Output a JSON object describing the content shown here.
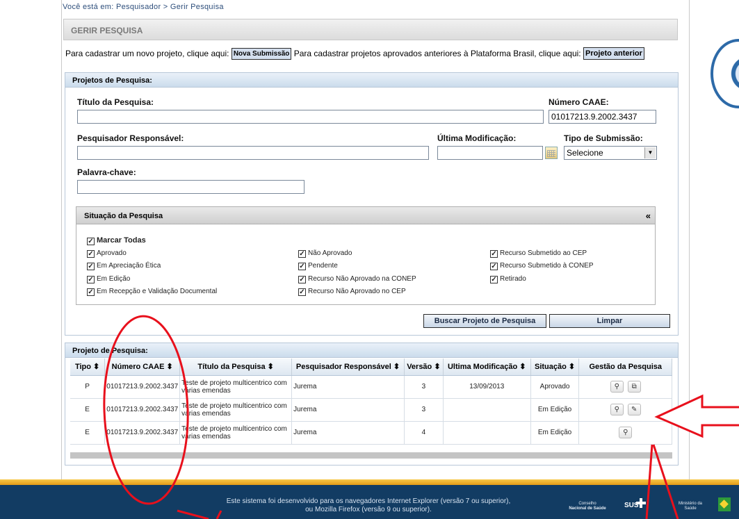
{
  "breadcrumb": "Você está em: Pesquisador > Gerir Pesquisa",
  "page_title": "GERIR PESQUISA",
  "submission": {
    "text_new": "Para cadastrar um novo projeto, clique aqui:",
    "btn_new": "Nova Submissão",
    "text_previous": "Para cadastrar projetos aprovados anteriores à Plataforma Brasil, clique aqui:",
    "btn_previous": "Projeto anterior"
  },
  "search": {
    "header": "Projetos de Pesquisa:",
    "titulo_label": "Título da Pesquisa:",
    "titulo_value": "",
    "caae_label": "Número CAAE:",
    "caae_value": "01017213.9.2002.3437",
    "pesquisador_label": "Pesquisador Responsável:",
    "pesquisador_value": "",
    "modificacao_label": "Última Modificação:",
    "modificacao_value": "",
    "tipo_label": "Tipo de Submissão:",
    "tipo_value": "Selecione",
    "palavra_label": "Palavra-chave:",
    "palavra_value": ""
  },
  "situacao": {
    "header": "Situação da Pesquisa",
    "collapse_glyph": "«",
    "check_glyph": "✓",
    "marcar_todas": "Marcar Todas",
    "col1": [
      "Aprovado",
      "Em Apreciação Ética",
      "Em Edição",
      "Em Recepção e Validação Documental"
    ],
    "col2": [
      "Não Aprovado",
      "Pendente",
      "Recurso Não Aprovado na CONEP",
      "Recurso Não Aprovado no CEP"
    ],
    "col3": [
      "Recurso Submetido ao CEP",
      "Recurso Submetido à CONEP",
      "Retirado"
    ]
  },
  "buttons": {
    "buscar": "Buscar Projeto de Pesquisa",
    "limpar": "Limpar"
  },
  "results": {
    "header": "Projeto de Pesquisa:",
    "columns": [
      "Tipo ⬍",
      "Número CAAE ⬍",
      "Título da Pesquisa ⬍",
      "Pesquisador Responsável ⬍",
      "Versão ⬍",
      "Ultima Modificação ⬍",
      "Situação ⬍",
      "Gestão da Pesquisa"
    ],
    "rows": [
      {
        "tipo": "P",
        "caae": "01017213.9.2002.3437",
        "titulo": "Teste de projeto multicentrico com várias emendas",
        "pesquisador": "Jurema",
        "versao": "3",
        "modificacao": "13/09/2013",
        "situacao": "Aprovado"
      },
      {
        "tipo": "E",
        "caae": "01017213.9.2002.3437",
        "titulo": "Teste de projeto multicentrico com várias emendas",
        "pesquisador": "Jurema",
        "versao": "3",
        "modificacao": "",
        "situacao": "Em Edição"
      },
      {
        "tipo": "E",
        "caae": "01017213.9.2002.3437",
        "titulo": "Teste de projeto multicentrico com várias emendas",
        "pesquisador": "Jurema",
        "versao": "4",
        "modificacao": "",
        "situacao": "Em Edição"
      }
    ],
    "icons": {
      "view": "⚲",
      "open": "⧉",
      "edit": "✎"
    }
  },
  "footer": {
    "line1": "Este sistema foi desenvolvido para os navegadores Internet Explorer (versão 7 ou superior),",
    "line2": "ou Mozilla Firefox (versão 9 ou superior).",
    "cns_l1": "Conselho",
    "cns_l2": "Nacional de Saúde",
    "sus": "SUS",
    "ministerio_l1": "Ministério da",
    "ministerio_l2": "Saúde"
  },
  "colors": {
    "annotation": "#e8101c",
    "footer_bg": "#123c63",
    "header_blue": "#cbdcec"
  }
}
